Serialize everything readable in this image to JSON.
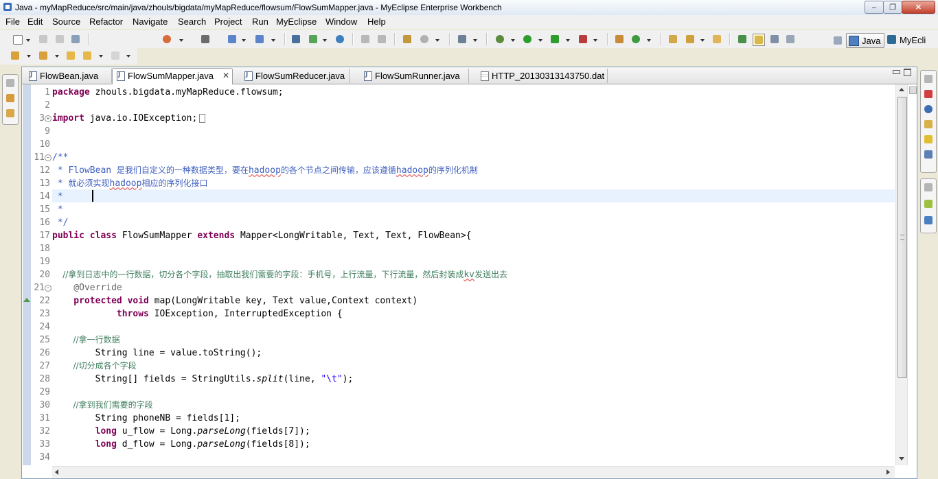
{
  "window": {
    "title": "Java - myMapReduce/src/main/java/zhouls/bigdata/myMapReduce/flowsum/FlowSumMapper.java - MyEclipse Enterprise Workbench"
  },
  "menu": [
    "File",
    "Edit",
    "Source",
    "Refactor",
    "Navigate",
    "Search",
    "Project",
    "Run",
    "MyEclipse",
    "Window",
    "Help"
  ],
  "perspectives": {
    "java": "Java",
    "myeclipse": "MyEcli"
  },
  "tabs": [
    {
      "label": "FlowBean.java"
    },
    {
      "label": "FlowSumMapper.java"
    },
    {
      "label": "FlowSumReducer.java"
    },
    {
      "label": "FlowSumRunner.java"
    },
    {
      "label": "HTTP_20130313143750.dat"
    }
  ],
  "active_tab": "FlowSumMapper.java",
  "editor": {
    "line_numbers": [
      "1",
      "2",
      "3",
      "9",
      "10",
      "11",
      "12",
      "13",
      "14",
      "15",
      "16",
      "17",
      "18",
      "19",
      "20",
      "21",
      "22",
      "23",
      "24",
      "25",
      "26",
      "27",
      "28",
      "29",
      "30",
      "31",
      "32",
      "33",
      "34"
    ],
    "t": {
      "package_kw": "package",
      "package_name": " zhouls.bigdata.myMapReduce.flowsum;",
      "import_kw": "import",
      "import_name": " java.io.IOException;",
      "doc_open": "/**",
      "doc12_a": " * FlowBean ",
      "doc12_b": "是我们自定义的一种数据类型，要在",
      "doc12_c": "hadoop",
      "doc12_d": "的各个节点之间传输，应该遵循",
      "doc12_e": "hadoop",
      "doc12_f": "的序列化机制",
      "doc13_a": " * ",
      "doc13_b": "就必须实现",
      "doc13_c": "hadoop",
      "doc13_d": "相应的序列化接口",
      "doc_star": " *",
      "doc_close": " */",
      "public_class_kw": "public class",
      "class_name": " FlowSumMapper ",
      "extends_kw": "extends",
      "class_rest": " Mapper<LongWritable, Text, Text, FlowBean>{",
      "c20_a": "    //拿到日志中的一行数据，切分各个字段，抽取出我们需要的字段：手机号，上行流量，下行流量，然后封装成",
      "c20_b": "kv",
      "c20_c": "发送出去",
      "override": "    @Override",
      "protected_void_kw": "    protected void",
      "map_sig": " map(LongWritable key, Text value,Context context)",
      "throws_kw": "            throws",
      "throws_rest": " IOException, InterruptedException {",
      "c25": "        //拿一行数据",
      "l26": "        String line = value.toString();",
      "c27": "        //切分成各个字段",
      "l28_a": "        String[] fields = StringUtils.",
      "l28_split": "split",
      "l28_b": "(line, ",
      "l28_str": "\"\\t\"",
      "l28_c": ");",
      "c30": "        //拿到我们需要的字段",
      "l31": "        String phoneNB = fields[1];",
      "long_kw": "        long",
      "l32_a": " u_flow = Long.",
      "parse_long": "parseLong",
      "l32_b": "(fields[7]);",
      "l33_a": " d_flow = Long.",
      "l33_b": "(fields[8]);"
    }
  },
  "icons": [
    "new-icon",
    "save-icon",
    "print-icon",
    "debug-icon",
    "run-icon",
    "search-icon",
    "perspective-icon",
    "minimize-icon",
    "maximize-icon"
  ]
}
